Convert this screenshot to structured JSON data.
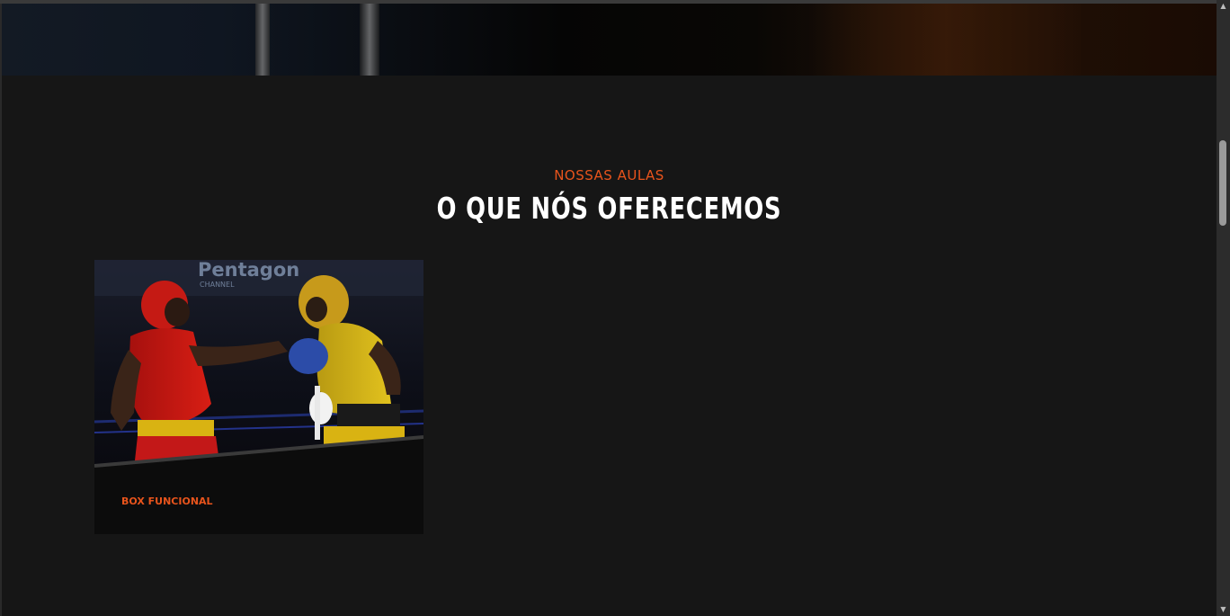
{
  "section": {
    "kicker": "NOSSAS AULAS",
    "title": "O QUE NÓS OFERECEMOS"
  },
  "cards": [
    {
      "label": "BOX FUNCIONAL",
      "image_sign_text": "Pentagon",
      "image_sign_sub": "CHANNEL"
    }
  ],
  "colors": {
    "accent": "#e8541c",
    "background": "#161616",
    "card_background": "#0c0c0c",
    "title": "#ffffff"
  },
  "scrollbar": {
    "up_icon": "scroll-up-arrow",
    "down_icon": "scroll-down-arrow"
  }
}
